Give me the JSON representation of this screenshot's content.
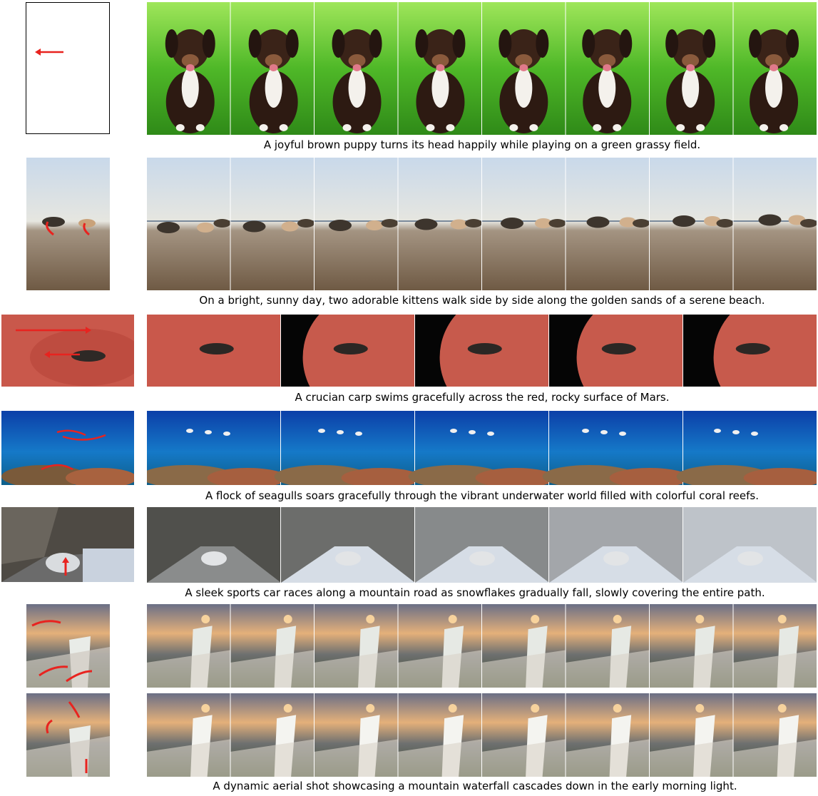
{
  "rows": [
    {
      "id": "puppy",
      "caption": "A joyful brown puppy turns its head happily while playing on a green grassy field.",
      "frames": 8
    },
    {
      "id": "kittens",
      "caption": "On a bright, sunny day, two adorable kittens walk side by side along the golden sands of a serene beach.",
      "frames": 8
    },
    {
      "id": "carp",
      "caption": "A crucian carp swims gracefully across the red, rocky surface of Mars.",
      "frames": 5
    },
    {
      "id": "seagulls",
      "caption": "A flock of seagulls soars gracefully through the vibrant underwater world filled with colorful coral reefs.",
      "frames": 5
    },
    {
      "id": "car",
      "caption": "A sleek sports car races along a mountain road as snowflakes gradually fall, slowly covering the entire path.",
      "frames": 5
    },
    {
      "id": "waterfall",
      "caption": "A dynamic aerial shot showcasing a mountain waterfall cascades down in the early morning light.",
      "frames": 8
    }
  ],
  "colors": {
    "arrow": "#e8231f",
    "border": "#000000",
    "caption": "#000000"
  }
}
